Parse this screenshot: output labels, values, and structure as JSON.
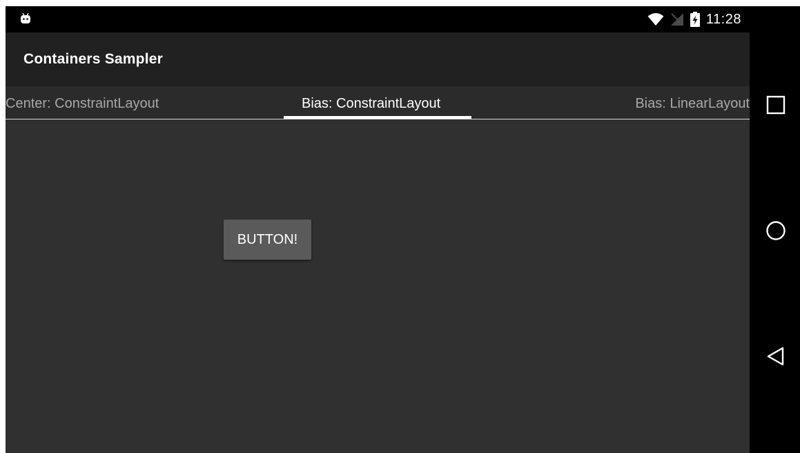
{
  "status_bar": {
    "time": "11:28"
  },
  "app_bar": {
    "title": "Containers Sampler"
  },
  "tabs": [
    {
      "label": "Center: ConstraintLayout",
      "active": false
    },
    {
      "label": "Bias: ConstraintLayout",
      "active": true
    },
    {
      "label": "Bias: LinearLayout",
      "active": false
    }
  ],
  "content": {
    "button_label": "BUTTON!"
  },
  "icons": {
    "status_left": "android-debug-icon",
    "wifi": "wifi-icon",
    "signal": "no-signal-icon",
    "battery": "battery-charging-icon",
    "recents": "recents-square-icon",
    "home": "home-circle-icon",
    "back": "back-triangle-icon"
  },
  "colors": {
    "app_bar": "#212121",
    "tab_bar": "#2b2b2b",
    "content_bg": "#303030",
    "button": "#5a5a5a",
    "active_tab": "#ffffff",
    "inactive_tab": "#a8a8a8"
  }
}
